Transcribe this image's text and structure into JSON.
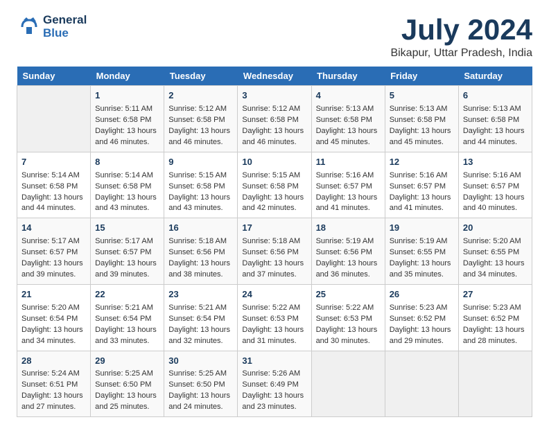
{
  "logo": {
    "name": "GeneralBlue",
    "line1": "General",
    "line2": "Blue"
  },
  "header": {
    "month_year": "July 2024",
    "location": "Bikapur, Uttar Pradesh, India"
  },
  "days_of_week": [
    "Sunday",
    "Monday",
    "Tuesday",
    "Wednesday",
    "Thursday",
    "Friday",
    "Saturday"
  ],
  "weeks": [
    [
      {
        "day": "",
        "info": ""
      },
      {
        "day": "1",
        "info": "Sunrise: 5:11 AM\nSunset: 6:58 PM\nDaylight: 13 hours\nand 46 minutes."
      },
      {
        "day": "2",
        "info": "Sunrise: 5:12 AM\nSunset: 6:58 PM\nDaylight: 13 hours\nand 46 minutes."
      },
      {
        "day": "3",
        "info": "Sunrise: 5:12 AM\nSunset: 6:58 PM\nDaylight: 13 hours\nand 46 minutes."
      },
      {
        "day": "4",
        "info": "Sunrise: 5:13 AM\nSunset: 6:58 PM\nDaylight: 13 hours\nand 45 minutes."
      },
      {
        "day": "5",
        "info": "Sunrise: 5:13 AM\nSunset: 6:58 PM\nDaylight: 13 hours\nand 45 minutes."
      },
      {
        "day": "6",
        "info": "Sunrise: 5:13 AM\nSunset: 6:58 PM\nDaylight: 13 hours\nand 44 minutes."
      }
    ],
    [
      {
        "day": "7",
        "info": "Sunrise: 5:14 AM\nSunset: 6:58 PM\nDaylight: 13 hours\nand 44 minutes."
      },
      {
        "day": "8",
        "info": "Sunrise: 5:14 AM\nSunset: 6:58 PM\nDaylight: 13 hours\nand 43 minutes."
      },
      {
        "day": "9",
        "info": "Sunrise: 5:15 AM\nSunset: 6:58 PM\nDaylight: 13 hours\nand 43 minutes."
      },
      {
        "day": "10",
        "info": "Sunrise: 5:15 AM\nSunset: 6:58 PM\nDaylight: 13 hours\nand 42 minutes."
      },
      {
        "day": "11",
        "info": "Sunrise: 5:16 AM\nSunset: 6:57 PM\nDaylight: 13 hours\nand 41 minutes."
      },
      {
        "day": "12",
        "info": "Sunrise: 5:16 AM\nSunset: 6:57 PM\nDaylight: 13 hours\nand 41 minutes."
      },
      {
        "day": "13",
        "info": "Sunrise: 5:16 AM\nSunset: 6:57 PM\nDaylight: 13 hours\nand 40 minutes."
      }
    ],
    [
      {
        "day": "14",
        "info": "Sunrise: 5:17 AM\nSunset: 6:57 PM\nDaylight: 13 hours\nand 39 minutes."
      },
      {
        "day": "15",
        "info": "Sunrise: 5:17 AM\nSunset: 6:57 PM\nDaylight: 13 hours\nand 39 minutes."
      },
      {
        "day": "16",
        "info": "Sunrise: 5:18 AM\nSunset: 6:56 PM\nDaylight: 13 hours\nand 38 minutes."
      },
      {
        "day": "17",
        "info": "Sunrise: 5:18 AM\nSunset: 6:56 PM\nDaylight: 13 hours\nand 37 minutes."
      },
      {
        "day": "18",
        "info": "Sunrise: 5:19 AM\nSunset: 6:56 PM\nDaylight: 13 hours\nand 36 minutes."
      },
      {
        "day": "19",
        "info": "Sunrise: 5:19 AM\nSunset: 6:55 PM\nDaylight: 13 hours\nand 35 minutes."
      },
      {
        "day": "20",
        "info": "Sunrise: 5:20 AM\nSunset: 6:55 PM\nDaylight: 13 hours\nand 34 minutes."
      }
    ],
    [
      {
        "day": "21",
        "info": "Sunrise: 5:20 AM\nSunset: 6:54 PM\nDaylight: 13 hours\nand 34 minutes."
      },
      {
        "day": "22",
        "info": "Sunrise: 5:21 AM\nSunset: 6:54 PM\nDaylight: 13 hours\nand 33 minutes."
      },
      {
        "day": "23",
        "info": "Sunrise: 5:21 AM\nSunset: 6:54 PM\nDaylight: 13 hours\nand 32 minutes."
      },
      {
        "day": "24",
        "info": "Sunrise: 5:22 AM\nSunset: 6:53 PM\nDaylight: 13 hours\nand 31 minutes."
      },
      {
        "day": "25",
        "info": "Sunrise: 5:22 AM\nSunset: 6:53 PM\nDaylight: 13 hours\nand 30 minutes."
      },
      {
        "day": "26",
        "info": "Sunrise: 5:23 AM\nSunset: 6:52 PM\nDaylight: 13 hours\nand 29 minutes."
      },
      {
        "day": "27",
        "info": "Sunrise: 5:23 AM\nSunset: 6:52 PM\nDaylight: 13 hours\nand 28 minutes."
      }
    ],
    [
      {
        "day": "28",
        "info": "Sunrise: 5:24 AM\nSunset: 6:51 PM\nDaylight: 13 hours\nand 27 minutes."
      },
      {
        "day": "29",
        "info": "Sunrise: 5:25 AM\nSunset: 6:50 PM\nDaylight: 13 hours\nand 25 minutes."
      },
      {
        "day": "30",
        "info": "Sunrise: 5:25 AM\nSunset: 6:50 PM\nDaylight: 13 hours\nand 24 minutes."
      },
      {
        "day": "31",
        "info": "Sunrise: 5:26 AM\nSunset: 6:49 PM\nDaylight: 13 hours\nand 23 minutes."
      },
      {
        "day": "",
        "info": ""
      },
      {
        "day": "",
        "info": ""
      },
      {
        "day": "",
        "info": ""
      }
    ]
  ]
}
